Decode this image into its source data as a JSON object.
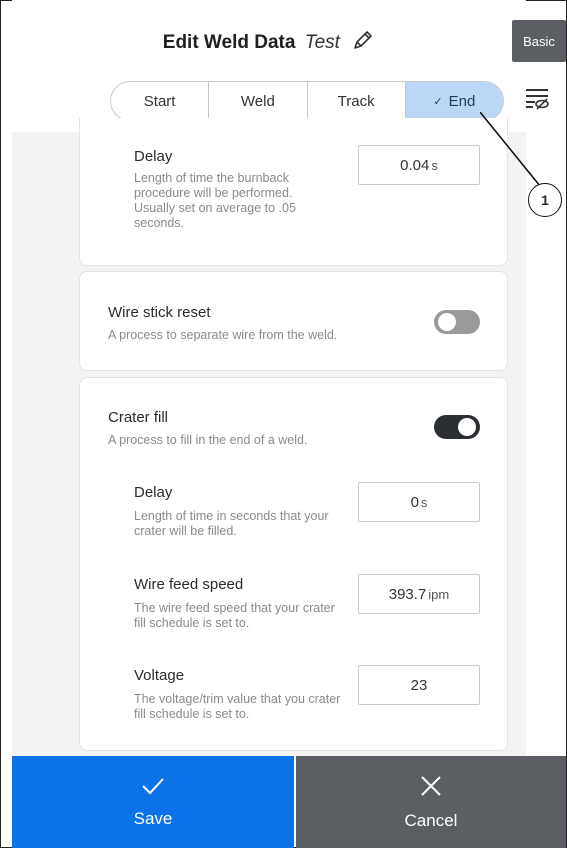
{
  "header": {
    "title": "Edit Weld Data",
    "name": "Test",
    "basic_label": "Basic"
  },
  "tabs": [
    {
      "label": "Start",
      "active": false
    },
    {
      "label": "Weld",
      "active": false
    },
    {
      "label": "Track",
      "active": false
    },
    {
      "label": "End",
      "active": true
    }
  ],
  "burnback": {
    "delay_label": "Delay",
    "delay_desc": "Length of time the burnback procedure will be performed. Usually set on average to .05 seconds.",
    "delay_value": "0.04",
    "delay_unit": "s"
  },
  "wire_stick": {
    "label": "Wire stick reset",
    "desc": "A process to separate wire from the weld.",
    "enabled": false
  },
  "crater": {
    "label": "Crater fill",
    "desc": "A process to fill in the end of a weld.",
    "enabled": true,
    "delay_label": "Delay",
    "delay_desc": "Length of time in seconds that your crater will be filled.",
    "delay_value": "0",
    "delay_unit": "s",
    "wfs_label": "Wire feed speed",
    "wfs_desc": "The wire feed speed that your crater fill schedule is set to.",
    "wfs_value": "393.7",
    "wfs_unit": "ipm",
    "voltage_label": "Voltage",
    "voltage_desc": "The voltage/trim value that you crater fill schedule is set to.",
    "voltage_value": "23"
  },
  "callout_number": "1",
  "footer": {
    "save_label": "Save",
    "cancel_label": "Cancel"
  },
  "colors": {
    "primary": "#0b73e7",
    "secondary": "#5b5f63",
    "active_tab": "#bcd7f5"
  },
  "icons": [
    "pencil-icon",
    "filter-hide-icon",
    "check-icon",
    "close-icon"
  ]
}
